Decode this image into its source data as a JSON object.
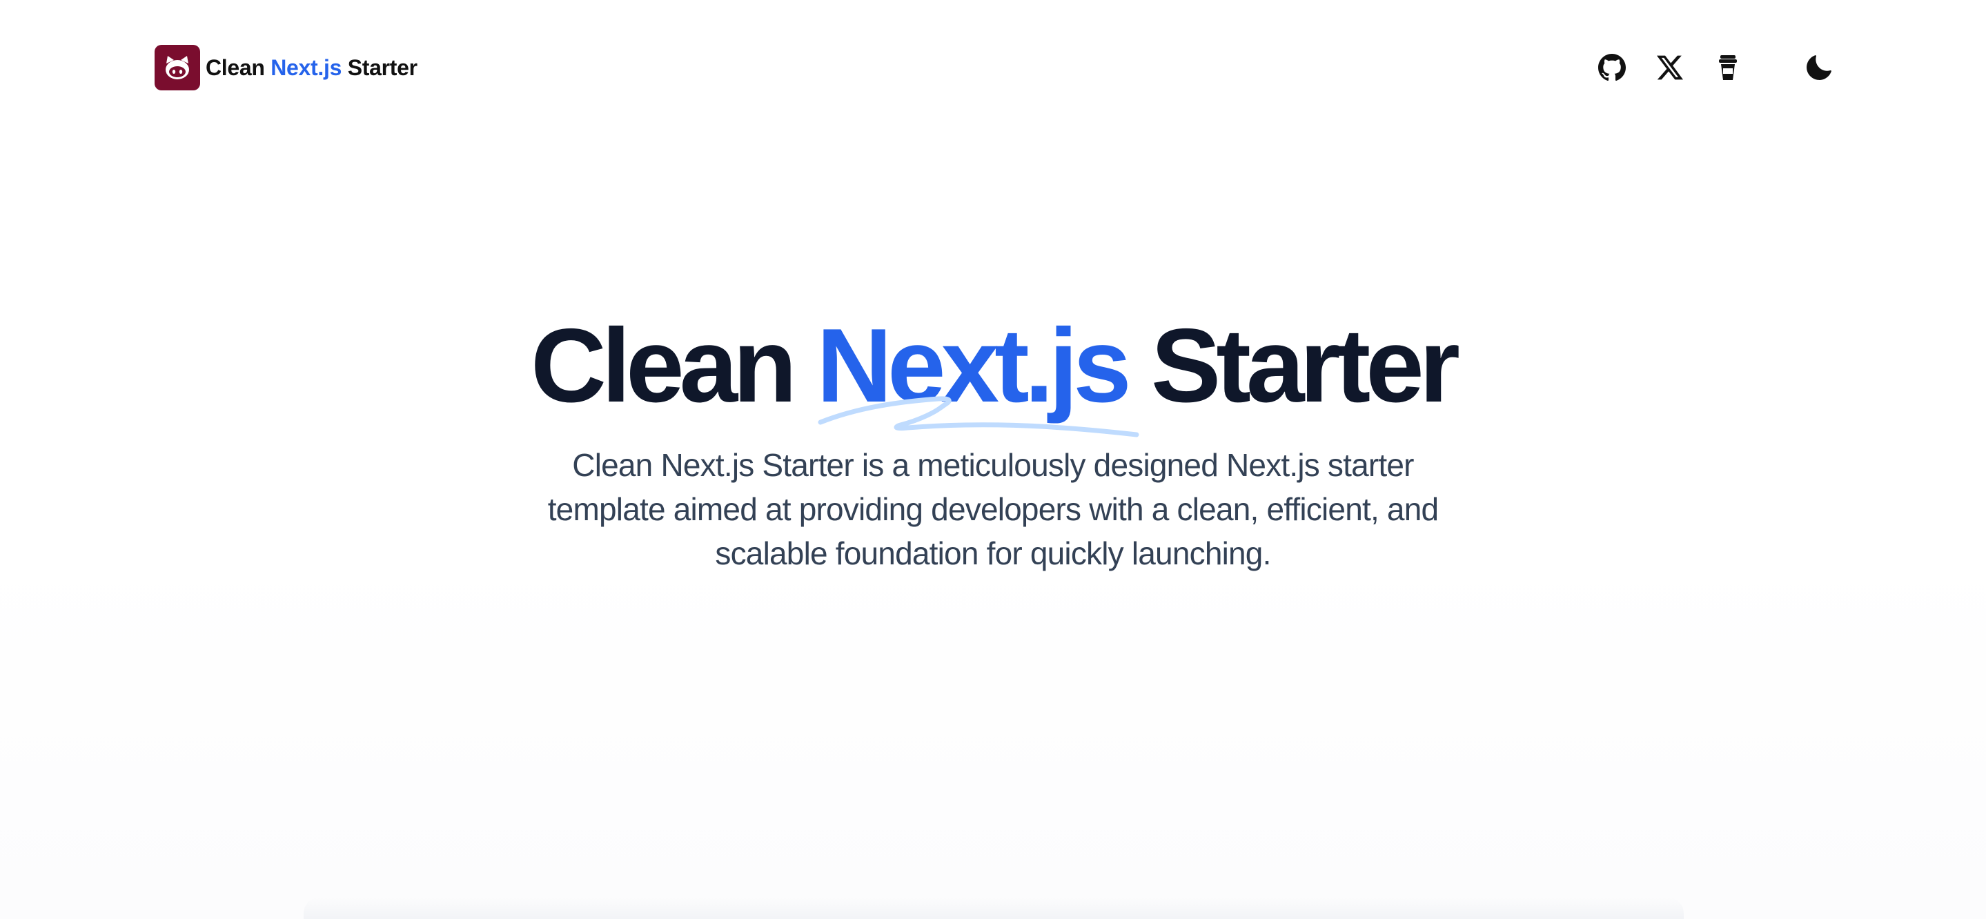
{
  "header": {
    "brand": {
      "part1": "Clean",
      "part2": "Next.js",
      "part3": "Starter"
    },
    "icons": [
      {
        "name": "github-icon"
      },
      {
        "name": "x-icon"
      },
      {
        "name": "coffee-cup-icon"
      },
      {
        "name": "moon-icon"
      }
    ]
  },
  "hero": {
    "title_part1": "Clean",
    "title_part2": "Next.js",
    "title_part3": "Starter",
    "subtitle": "Clean Next.js Starter is a meticulously designed Next.js starter template aimed at providing developers with a clean, efficient, and scalable foundation for quickly launching."
  },
  "colors": {
    "accent": "#2563eb",
    "heading": "#0f172a",
    "body": "#334155",
    "logo_bg": "#7a0d2e",
    "squiggle": "#bfdbfe"
  }
}
